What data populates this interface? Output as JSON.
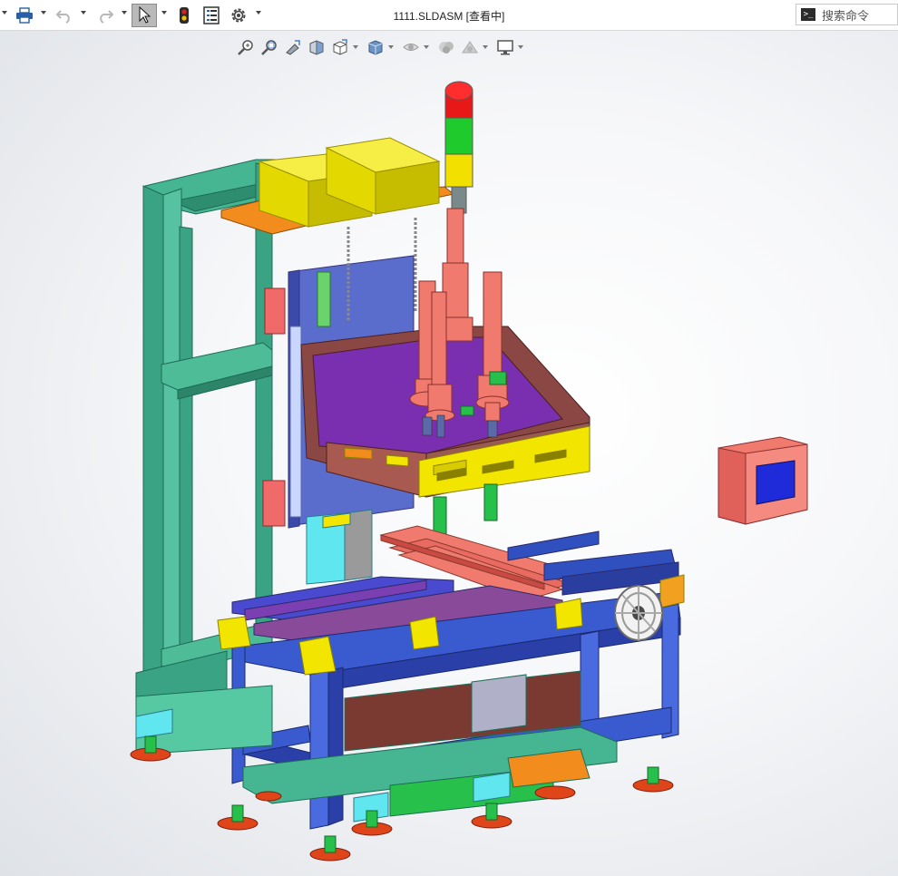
{
  "window": {
    "title": "1111.SLDASM [查看中]"
  },
  "toolbar": {
    "items": [
      {
        "name": "print-icon",
        "has_dropdown": true
      },
      {
        "name": "undo-icon",
        "has_dropdown": true,
        "disabled": true
      },
      {
        "name": "redo-icon",
        "has_dropdown": true,
        "disabled": true
      },
      {
        "name": "select-cursor-icon",
        "has_dropdown": true,
        "active": true
      },
      {
        "name": "traffic-light-icon",
        "has_dropdown": false
      },
      {
        "name": "file-properties-icon",
        "has_dropdown": false
      },
      {
        "name": "gear-icon",
        "has_dropdown": true
      }
    ]
  },
  "search": {
    "placeholder": "搜索命令",
    "icon": "command-prompt-icon"
  },
  "heads_up_toolbar": {
    "items": [
      "zoom-to-fit-icon",
      "zoom-to-area-icon",
      "previous-view-icon",
      "section-view-icon",
      "view-orientation-icon",
      "display-style-icon",
      "hide-show-items-icon",
      "edit-appearance-icon",
      "apply-scene-icon",
      "view-settings-icon"
    ]
  },
  "colors": {
    "frame_green": "#3fae8c",
    "conveyor_blue": "#3050c0",
    "yellow": "#f2e600",
    "salmon": "#f07a6e",
    "purple": "#7b3fb2",
    "brown": "#8e4a46",
    "viewport_bg": "#f4f5f7"
  }
}
